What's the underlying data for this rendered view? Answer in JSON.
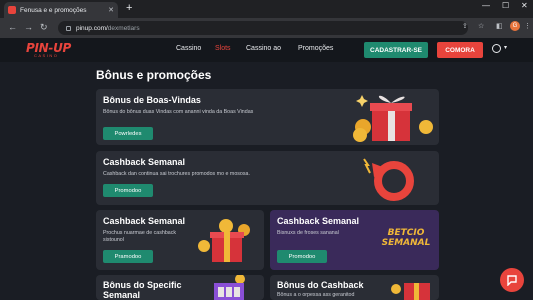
{
  "browser": {
    "tab_title": "Fenusa e e promoções",
    "url_host": "pinup.com/",
    "url_path": "dexmetlars",
    "new_tab": "+",
    "close_tab": "✕",
    "win_min": "—",
    "win_max": "☐",
    "win_close": "✕",
    "back": "←",
    "forward": "→",
    "reload": "↻",
    "profile_initial": "G"
  },
  "site": {
    "logo": "PIN-UP",
    "logo_sub": "CASINO",
    "nav": [
      "Cassino",
      "Slots",
      "Cassino ao",
      "Promoções"
    ],
    "register": "CADASTRAR-SE",
    "login": "COMORA"
  },
  "page": {
    "title": "Bônus e promoções",
    "cards": [
      {
        "title": "Bônus de Boas-Vindas",
        "desc": "Bônus do bônus duas Vindas com ananni vinda da Boas Vindas",
        "button": "Powrledes"
      },
      {
        "title": "Cashback Semanal",
        "desc": "Cashback dan continua sai trochures promodos mo e mososa.",
        "button": "Promodoo"
      },
      {
        "title": "Cashback Semanal",
        "desc": "Prochus nuarmae de cashback sistounol",
        "button": "Pramodoo"
      },
      {
        "title": "Cashback Semanal",
        "desc": "Bisnuxs de froses sananal",
        "button": "Promodoo"
      },
      {
        "title": "Bônus do Specific Semanal",
        "desc": "",
        "button": ""
      },
      {
        "title": "Bônus do Cashback",
        "desc": "Bônus a o orpessa ass geranitod",
        "button": ""
      }
    ],
    "banner_text": [
      "BETCIO",
      "SEMANAL"
    ]
  },
  "colors": {
    "accent": "#e8443c",
    "green": "#1f8a6f",
    "bg": "#1a1d24"
  }
}
